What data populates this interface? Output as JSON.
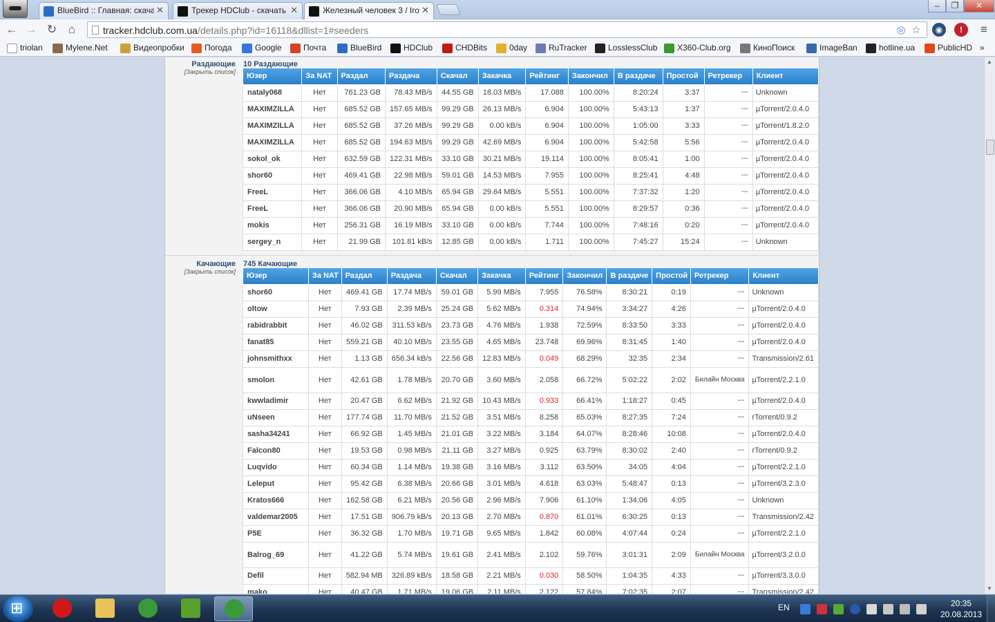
{
  "browser": {
    "tabs": [
      {
        "title": "BlueBird :: Главная: скача",
        "icon_color": "#2d6cc4",
        "active": false
      },
      {
        "title": "Трекер HDClub - скачать",
        "icon_color": "#111111",
        "active": false
      },
      {
        "title": "Железный человек 3 / Iro",
        "icon_color": "#111111",
        "active": true
      }
    ],
    "window_controls": [
      "minimize",
      "maximize",
      "close"
    ],
    "url_main": "tracker.hdclub.com.ua",
    "url_rest": "/details.php?id=16118&dllist=1#seeders",
    "nav_icons": [
      "back-icon",
      "forward-icon",
      "reload-icon",
      "home-icon"
    ],
    "bookmarks": [
      {
        "label": "triolan",
        "icon_color": "#ffffff"
      },
      {
        "label": "Mylene.Net",
        "icon_color": "#8a6a4a"
      },
      {
        "label": "Видеопробки",
        "icon_color": "#c9a23a"
      },
      {
        "label": "Погода",
        "icon_color": "#e65c1c"
      },
      {
        "label": "Google",
        "icon_color": "#3b73d9"
      },
      {
        "label": "Почта",
        "icon_color": "#d8402a"
      },
      {
        "label": "BlueBird",
        "icon_color": "#2d6cc4"
      },
      {
        "label": "HDClub",
        "icon_color": "#111111"
      },
      {
        "label": "CHDBits",
        "icon_color": "#c01a1a"
      },
      {
        "label": "0day",
        "icon_color": "#e0b030"
      },
      {
        "label": "RuTracker",
        "icon_color": "#6a7fb0"
      },
      {
        "label": "LosslessClub",
        "icon_color": "#222222"
      },
      {
        "label": "X360-Club.org",
        "icon_color": "#3a9a2a"
      },
      {
        "label": "КиноПоиск",
        "icon_color": "#777777"
      },
      {
        "label": "ImageBan",
        "icon_color": "#3a6aa8"
      },
      {
        "label": "hotline.ua",
        "icon_color": "#222222"
      },
      {
        "label": "PublicHD",
        "icon_color": "#e04a1a"
      }
    ],
    "bookmarks_more": "»"
  },
  "seeders": {
    "side_label": "Раздающие",
    "close_link": "[Закрыть список]",
    "heading": "10 Раздающие",
    "columns": [
      "Юзер",
      "За NAT",
      "Раздал",
      "Раздача",
      "Скачал",
      "Закачка",
      "Рейтинг",
      "Закончил",
      "В раздаче",
      "Простой",
      "Ретрекер",
      "Клиент"
    ],
    "rows": [
      {
        "user": "nataly068",
        "cls": "u-blue",
        "nat": "Нет",
        "uploaded": "761.23 GB",
        "up_speed": "78.43 MB/s",
        "downloaded": "44.55 GB",
        "down_speed": "18.03 MB/s",
        "ratio": "17.088",
        "low": false,
        "done": "100.00%",
        "seeding": "8:20:24",
        "idle": "3:37",
        "retracker": "---",
        "client": "Unknown"
      },
      {
        "user": "MAXIMZILLA",
        "cls": "u-blue",
        "nat": "Нет",
        "uploaded": "685.52 GB",
        "up_speed": "157.65 MB/s",
        "downloaded": "99.29 GB",
        "down_speed": "26.13 MB/s",
        "ratio": "6.904",
        "low": false,
        "done": "100.00%",
        "seeding": "5:43:13",
        "idle": "1:37",
        "retracker": "---",
        "client": "µTorrent/2.0.4.0"
      },
      {
        "user": "MAXIMZILLA",
        "cls": "u-blue",
        "nat": "Нет",
        "uploaded": "685.52 GB",
        "up_speed": "37.26 MB/s",
        "downloaded": "99.29 GB",
        "down_speed": "0.00 kB/s",
        "ratio": "6.904",
        "low": false,
        "done": "100.00%",
        "seeding": "1:05:00",
        "idle": "3:33",
        "retracker": "---",
        "client": "µTorrent/1.8.2.0"
      },
      {
        "user": "MAXIMZILLA",
        "cls": "u-blue",
        "nat": "Нет",
        "uploaded": "685.52 GB",
        "up_speed": "194.63 MB/s",
        "downloaded": "99.29 GB",
        "down_speed": "42.69 MB/s",
        "ratio": "6.904",
        "low": false,
        "done": "100.00%",
        "seeding": "5:42:58",
        "idle": "5:56",
        "retracker": "---",
        "client": "µTorrent/2.0.4.0"
      },
      {
        "user": "sokol_ok",
        "cls": "u-red",
        "nat": "Нет",
        "uploaded": "632.59 GB",
        "up_speed": "122.31 MB/s",
        "downloaded": "33.10 GB",
        "down_speed": "30.21 MB/s",
        "ratio": "19.114",
        "low": false,
        "done": "100.00%",
        "seeding": "8:05:41",
        "idle": "1:00",
        "retracker": "---",
        "client": "µTorrent/2.0.4.0"
      },
      {
        "user": "shor60",
        "cls": "u-blue",
        "nat": "Нет",
        "uploaded": "469.41 GB",
        "up_speed": "22.98 MB/s",
        "downloaded": "59.01 GB",
        "down_speed": "14.53 MB/s",
        "ratio": "7.955",
        "low": false,
        "done": "100.00%",
        "seeding": "8:25:41",
        "idle": "4:48",
        "retracker": "---",
        "client": "µTorrent/2.0.4.0"
      },
      {
        "user": "FreeL",
        "cls": "u-blue",
        "nat": "Нет",
        "uploaded": "366.06 GB",
        "up_speed": "4.10 MB/s",
        "downloaded": "65.94 GB",
        "down_speed": "29.64 MB/s",
        "ratio": "5.551",
        "low": false,
        "done": "100.00%",
        "seeding": "7:37:32",
        "idle": "1:20",
        "retracker": "---",
        "client": "µTorrent/2.0.4.0"
      },
      {
        "user": "FreeL",
        "cls": "u-blue",
        "nat": "Нет",
        "uploaded": "366.06 GB",
        "up_speed": "20.90 MB/s",
        "downloaded": "65.94 GB",
        "down_speed": "0.00 kB/s",
        "ratio": "5.551",
        "low": false,
        "done": "100.00%",
        "seeding": "8:29:57",
        "idle": "0:36",
        "retracker": "---",
        "client": "µTorrent/2.0.4.0"
      },
      {
        "user": "mokis",
        "cls": "u-blue",
        "nat": "Нет",
        "uploaded": "256.31 GB",
        "up_speed": "16.19 MB/s",
        "downloaded": "33.10 GB",
        "down_speed": "0.00 kB/s",
        "ratio": "7.744",
        "low": false,
        "done": "100.00%",
        "seeding": "7:48:16",
        "idle": "0:20",
        "retracker": "---",
        "client": "µTorrent/2.0.4.0"
      },
      {
        "user": "sergey_n",
        "cls": "u-green",
        "nat": "Нет",
        "uploaded": "21.99 GB",
        "up_speed": "101.81 kB/s",
        "downloaded": "12.85 GB",
        "down_speed": "0.00 kB/s",
        "ratio": "1.711",
        "low": false,
        "done": "100.00%",
        "seeding": "7:45:27",
        "idle": "15:24",
        "retracker": "---",
        "client": "Unknown"
      }
    ]
  },
  "leechers": {
    "side_label": "Качающие",
    "close_link": "[Закрыть список]",
    "heading": "745 Качающие",
    "columns": [
      "Юзер",
      "За NAT",
      "Раздал",
      "Раздача",
      "Скачал",
      "Закачка",
      "Рейтинг",
      "Закончил",
      "В раздаче",
      "Простой",
      "Ретрекер",
      "Клиент"
    ],
    "rows": [
      {
        "user": "shor60",
        "cls": "u-blue",
        "nat": "Нет",
        "uploaded": "469.41 GB",
        "up_speed": "17.74 MB/s",
        "downloaded": "59.01 GB",
        "down_speed": "5.99 MB/s",
        "ratio": "7.955",
        "low": false,
        "done": "76.58%",
        "seeding": "8:30:21",
        "idle": "0:19",
        "retracker": "---",
        "client": "Unknown"
      },
      {
        "user": "oltow",
        "cls": "u-blue",
        "nat": "Нет",
        "uploaded": "7.93 GB",
        "up_speed": "2.39 MB/s",
        "downloaded": "25.24 GB",
        "down_speed": "5.62 MB/s",
        "ratio": "0.314",
        "low": true,
        "done": "74.94%",
        "seeding": "3:34:27",
        "idle": "4:26",
        "retracker": "---",
        "client": "µTorrent/2.0.4.0"
      },
      {
        "user": "rabidrabbit",
        "cls": "u-blue",
        "nat": "Нет",
        "uploaded": "46.02 GB",
        "up_speed": "311.53 kB/s",
        "downloaded": "23.73 GB",
        "down_speed": "4.76 MB/s",
        "ratio": "1.938",
        "low": false,
        "done": "72.59%",
        "seeding": "8:33:50",
        "idle": "3:33",
        "retracker": "---",
        "client": "µTorrent/2.0.4.0"
      },
      {
        "user": "fanat85",
        "cls": "u-purple",
        "nat": "Нет",
        "uploaded": "559.21 GB",
        "up_speed": "40.10 MB/s",
        "downloaded": "23.55 GB",
        "down_speed": "4.65 MB/s",
        "ratio": "23.748",
        "low": false,
        "done": "69.96%",
        "seeding": "8:31:45",
        "idle": "1:40",
        "retracker": "---",
        "client": "µTorrent/2.0.4.0"
      },
      {
        "user": "johnsmithxx",
        "cls": "u-red",
        "nat": "Нет",
        "uploaded": "1.13 GB",
        "up_speed": "656.34 kB/s",
        "downloaded": "22.56 GB",
        "down_speed": "12.83 MB/s",
        "ratio": "0.049",
        "low": true,
        "done": "68.29%",
        "seeding": "32:35",
        "idle": "2:34",
        "retracker": "---",
        "client": "Transmission/2.61"
      },
      {
        "user": "smolon",
        "cls": "u-red",
        "nat": "Нет",
        "uploaded": "42.61 GB",
        "up_speed": "1.78 MB/s",
        "downloaded": "20.70 GB",
        "down_speed": "3.60 MB/s",
        "ratio": "2.058",
        "low": false,
        "done": "66.72%",
        "seeding": "5:02:22",
        "idle": "2:02",
        "retracker": "Билайн Москва",
        "client": "µTorrent/2.2.1.0",
        "tall": true
      },
      {
        "user": "kwwladimir",
        "cls": "u-red",
        "nat": "Нет",
        "uploaded": "20.47 GB",
        "up_speed": "6.62 MB/s",
        "downloaded": "21.92 GB",
        "down_speed": "10.43 MB/s",
        "ratio": "0.933",
        "low": true,
        "done": "66.41%",
        "seeding": "1:18:27",
        "idle": "0:45",
        "retracker": "---",
        "client": "µTorrent/2.0.4.0"
      },
      {
        "user": "uNseen",
        "cls": "u-blue",
        "nat": "Нет",
        "uploaded": "177.74 GB",
        "up_speed": "11.70 MB/s",
        "downloaded": "21.52 GB",
        "down_speed": "3.51 MB/s",
        "ratio": "8.258",
        "low": false,
        "done": "65.03%",
        "seeding": "8:27:35",
        "idle": "7:24",
        "retracker": "---",
        "client": "rTorrent/0.9.2"
      },
      {
        "user": "sasha34241",
        "cls": "u-red",
        "nat": "Нет",
        "uploaded": "66.92 GB",
        "up_speed": "1.45 MB/s",
        "downloaded": "21.01 GB",
        "down_speed": "3.22 MB/s",
        "ratio": "3.184",
        "low": false,
        "done": "64.07%",
        "seeding": "8:28:46",
        "idle": "10:08",
        "retracker": "---",
        "client": "µTorrent/2.0.4.0"
      },
      {
        "user": "Falcon80",
        "cls": "u-blue",
        "nat": "Нет",
        "uploaded": "19.53 GB",
        "up_speed": "0.98 MB/s",
        "downloaded": "21.11 GB",
        "down_speed": "3.27 MB/s",
        "ratio": "0.925",
        "low": false,
        "done": "63.79%",
        "seeding": "8:30:02",
        "idle": "2:40",
        "retracker": "---",
        "client": "rTorrent/0.9.2"
      },
      {
        "user": "Luqvido",
        "cls": "u-purple",
        "nat": "Нет",
        "uploaded": "60.34 GB",
        "up_speed": "1.14 MB/s",
        "downloaded": "19.38 GB",
        "down_speed": "3.16 MB/s",
        "ratio": "3.112",
        "low": false,
        "done": "63.50%",
        "seeding": "34:05",
        "idle": "4:04",
        "retracker": "---",
        "client": "µTorrent/2.2.1.0"
      },
      {
        "user": "Leleput",
        "cls": "u-purple",
        "nat": "Нет",
        "uploaded": "95.42 GB",
        "up_speed": "6.38 MB/s",
        "downloaded": "20.66 GB",
        "down_speed": "3.01 MB/s",
        "ratio": "4.618",
        "low": false,
        "done": "63.03%",
        "seeding": "5:48:47",
        "idle": "0:13",
        "retracker": "---",
        "client": "µTorrent/3.2.3.0"
      },
      {
        "user": "Kratos666",
        "cls": "u-purple",
        "nat": "Нет",
        "uploaded": "162.58 GB",
        "up_speed": "6.21 MB/s",
        "downloaded": "20.56 GB",
        "down_speed": "2.96 MB/s",
        "ratio": "7.906",
        "low": false,
        "done": "61.10%",
        "seeding": "1:34:06",
        "idle": "4:05",
        "retracker": "---",
        "client": "Unknown"
      },
      {
        "user": "valdemar2005",
        "cls": "u-red",
        "nat": "Нет",
        "uploaded": "17.51 GB",
        "up_speed": "906.79 kB/s",
        "downloaded": "20.13 GB",
        "down_speed": "2.70 MB/s",
        "ratio": "0.870",
        "low": true,
        "done": "61.01%",
        "seeding": "6:30:25",
        "idle": "0:13",
        "retracker": "---",
        "client": "Transmission/2.42"
      },
      {
        "user": "P5E",
        "cls": "u-blue",
        "nat": "Нет",
        "uploaded": "36.32 GB",
        "up_speed": "1.70 MB/s",
        "downloaded": "19.71 GB",
        "down_speed": "9.65 MB/s",
        "ratio": "1.842",
        "low": false,
        "done": "60.08%",
        "seeding": "4:07:44",
        "idle": "0:24",
        "retracker": "---",
        "client": "µTorrent/2.2.1.0"
      },
      {
        "user": "Balrog_69",
        "cls": "u-blue",
        "nat": "Нет",
        "uploaded": "41.22 GB",
        "up_speed": "5.74 MB/s",
        "downloaded": "19.61 GB",
        "down_speed": "2.41 MB/s",
        "ratio": "2.102",
        "low": false,
        "done": "59.76%",
        "seeding": "3:01:31",
        "idle": "2:09",
        "retracker": "Билайн Москва",
        "client": "µTorrent/3.2.0.0",
        "tall": true
      },
      {
        "user": "Defil",
        "cls": "u-black",
        "nat": "Нет",
        "uploaded": "582.94 MB",
        "up_speed": "326.89 kB/s",
        "downloaded": "18.58 GB",
        "down_speed": "2.21 MB/s",
        "ratio": "0.030",
        "low": true,
        "done": "58.50%",
        "seeding": "1:04:35",
        "idle": "4:33",
        "retracker": "---",
        "client": "µTorrent/3.3.0.0"
      },
      {
        "user": "mako",
        "cls": "u-blue",
        "nat": "Нет",
        "uploaded": "40.47 GB",
        "up_speed": "1.71 MB/s",
        "downloaded": "19.06 GB",
        "down_speed": "2.11 MB/s",
        "ratio": "2.122",
        "low": false,
        "done": "57.84%",
        "seeding": "7:02:35",
        "idle": "2:07",
        "retracker": "---",
        "client": "Transmission/2.42"
      }
    ]
  },
  "taskbar": {
    "apps": [
      {
        "name": "opera",
        "color": "#d01818",
        "active": false
      },
      {
        "name": "explorer",
        "color": "#e8c35a",
        "active": false
      },
      {
        "name": "chrome",
        "color": "#3a9a3a",
        "active": false
      },
      {
        "name": "utorrent",
        "color": "#5aa02c",
        "active": false
      },
      {
        "name": "chrome",
        "color": "#3a9a3a",
        "active": true
      }
    ],
    "lang": "EN",
    "time": "20:35",
    "date": "20.08.2013"
  }
}
